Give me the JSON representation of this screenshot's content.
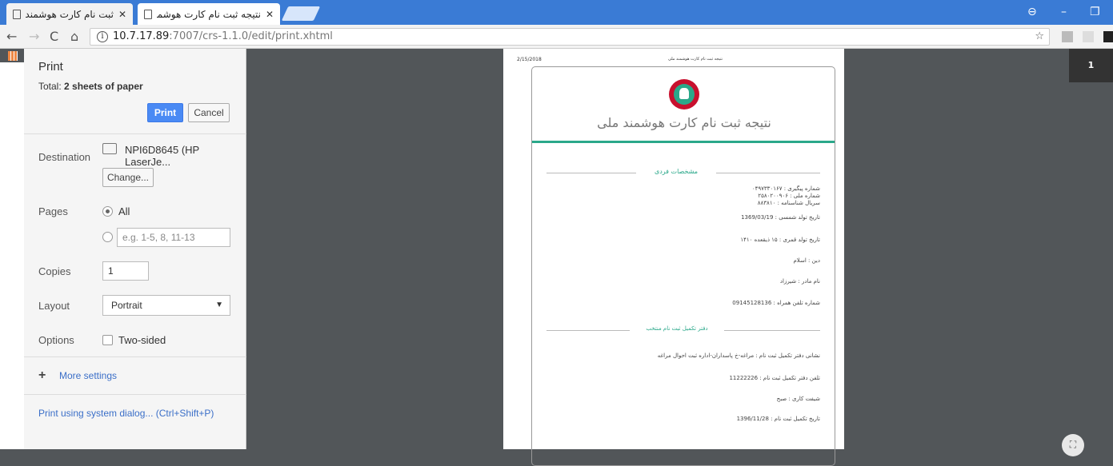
{
  "browser": {
    "tabs": [
      {
        "title": "ثبت نام کارت هوشمند ملی"
      },
      {
        "title": "نتیجه ثبت نام کارت هوشمند"
      }
    ],
    "url_host": "10.7.17.89",
    "url_path": ":7007/crs-1.1.0/edit/print.xhtml",
    "accent": "#3a7bd5"
  },
  "print_panel": {
    "title": "Print",
    "total_prefix": "Total: ",
    "total_value": "2 sheets of paper",
    "print_label": "Print",
    "cancel_label": "Cancel",
    "destination_label": "Destination",
    "destination_value": "NPI6D8645 (HP LaserJe...",
    "change_label": "Change...",
    "pages_label": "Pages",
    "pages_all": "All",
    "pages_placeholder": "e.g. 1-5, 8, 11-13",
    "copies_label": "Copies",
    "copies_value": "1",
    "layout_label": "Layout",
    "layout_value": "Portrait",
    "options_label": "Options",
    "two_sided_label": "Two-sided",
    "more_settings": "More settings",
    "system_dialog": "Print using system dialog... (Ctrl+Shift+P)"
  },
  "preview": {
    "date": "2/15/2018",
    "header_small": "نتیجه ثبت نام کارت هوشمند ملی",
    "main_title": "نتیجه ثبت نام کارت هوشمند ملی",
    "section1": "مشخصات فردی",
    "tracking": "شماره پیگیری : ۰۴۹۷۳۳۰۱۶۷",
    "national_id": "شماره ملی : ۲۵۸۰۲۰۰۹۰۶",
    "serial": "سریال شناسنامه : ۸۸۳۸۱۰",
    "birth_solar": "تاریخ تولد شمسی : 1369/03/19",
    "birth_lunar": "تاریخ تولد قمری : ۱۵ ذیقعده ۱۴۱۰",
    "religion": "دین : اسلام",
    "mother": "نام مادر : شیرزاد",
    "mobile": "شماره تلفن همراه : 09145128136",
    "section2": "دفتر تکمیل ثبت نام منتخب",
    "office_address": "نشانی دفتر تکمیل ثبت نام : مراغه-خ پاسداران-اداره ثبت احوال مراغه",
    "office_phone": "تلفن دفتر تکمیل ثبت نام : 11222226",
    "shift": "شیفت کاری : صبح",
    "completion_date": "تاریخ تکمیل ثبت نام : 1396/11/28",
    "page_number": "1",
    "teal": "#2aa88a"
  }
}
